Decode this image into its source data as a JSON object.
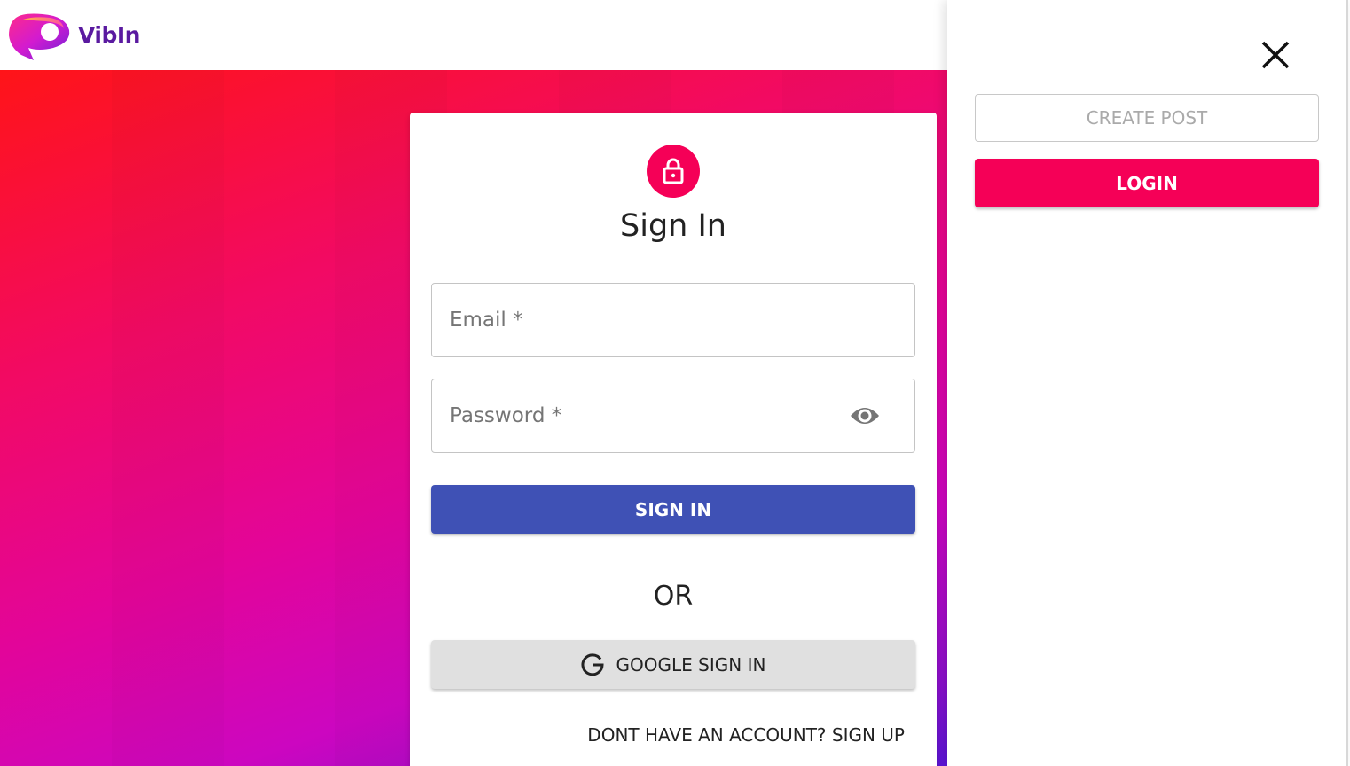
{
  "header": {
    "logo_icon": "chat-bubble-logo-icon",
    "brand_name": "VibIn"
  },
  "colors": {
    "accent_pink": "#f50057",
    "primary_indigo": "#3f51b5",
    "brand_purple": "#5a1aa0"
  },
  "signin_card": {
    "icon": "lock-icon",
    "title": "Sign In",
    "email": {
      "placeholder": "Email *",
      "value": ""
    },
    "password": {
      "placeholder": "Password *",
      "value": "",
      "toggle_icon": "eye-icon"
    },
    "signin_button": "SIGN IN",
    "separator": "OR",
    "google_button": {
      "icon": "google-g-icon",
      "label": "GOOGLE SIGN IN"
    },
    "signup_link": "DONT HAVE AN ACCOUNT? SIGN UP"
  },
  "drawer": {
    "close_icon": "close-icon",
    "create_post_label": "CREATE POST",
    "login_label": "LOGIN"
  }
}
